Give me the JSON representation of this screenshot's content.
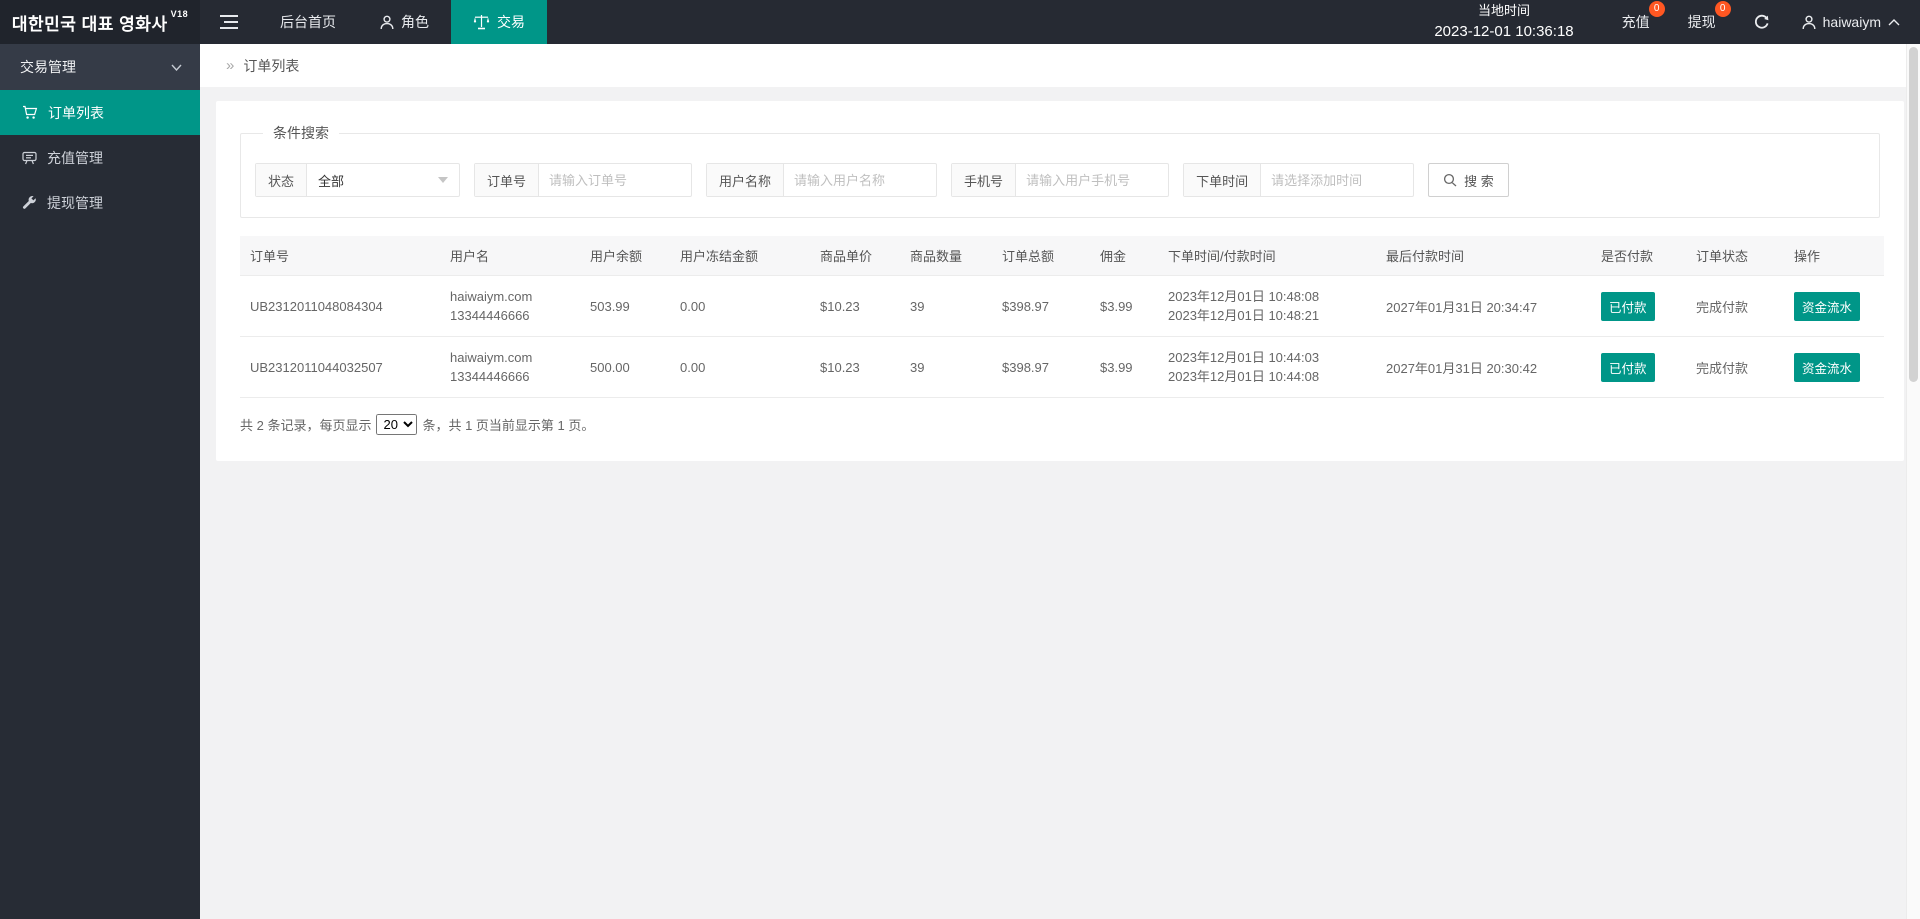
{
  "colors": {
    "accent": "#009688",
    "notification_badge": "#ff5722"
  },
  "topbar": {
    "logo": "대한민국 대표 영화사",
    "logo_version": "V18",
    "nav_home": "后台首页",
    "nav_role": "角色",
    "nav_trade": "交易",
    "local_time_label": "当地时间",
    "local_time_value": "2023-12-01 10:36:18",
    "recharge_label": "充值",
    "recharge_badge": "0",
    "withdraw_label": "提现",
    "withdraw_badge": "0",
    "username": "haiwaiym"
  },
  "sidebar": {
    "group_label": "交易管理",
    "items": [
      {
        "label": "订单列表"
      },
      {
        "label": "充值管理"
      },
      {
        "label": "提现管理"
      }
    ]
  },
  "breadcrumb": {
    "separator": "»",
    "current": "订单列表"
  },
  "search": {
    "legend": "条件搜索",
    "status_label": "状态",
    "status_value": "全部",
    "order_label": "订单号",
    "order_placeholder": "请输入订单号",
    "user_label": "用户名称",
    "user_placeholder": "请输入用户名称",
    "phone_label": "手机号",
    "phone_placeholder": "请输入用户手机号",
    "time_label": "下单时间",
    "time_placeholder": "请选择添加时间",
    "button_label": "搜 索"
  },
  "table": {
    "headers": [
      "订单号",
      "用户名",
      "用户余额",
      "用户冻结金额",
      "商品单价",
      "商品数量",
      "订单总额",
      "佣金",
      "下单时间/付款时间",
      "最后付款时间",
      "是否付款",
      "订单状态",
      "操作"
    ],
    "rows": [
      {
        "order_no": "UB2312011048084304",
        "user_name": "haiwaiym.com",
        "user_phone": "13344446666",
        "balance": "503.99",
        "frozen": "0.00",
        "unit_price": "$10.23",
        "quantity": "39",
        "total": "$398.97",
        "commission": "$3.99",
        "order_time": "2023年12月01日 10:48:08",
        "pay_time": "2023年12月01日 10:48:21",
        "last_pay_time": "2027年01月31日 20:34:47",
        "paid_badge": "已付款",
        "order_status": "完成付款",
        "action_label": "资金流水"
      },
      {
        "order_no": "UB2312011044032507",
        "user_name": "haiwaiym.com",
        "user_phone": "13344446666",
        "balance": "500.00",
        "frozen": "0.00",
        "unit_price": "$10.23",
        "quantity": "39",
        "total": "$398.97",
        "commission": "$3.99",
        "order_time": "2023年12月01日 10:44:03",
        "pay_time": "2023年12月01日 10:44:08",
        "last_pay_time": "2027年01月31日 20:30:42",
        "paid_badge": "已付款",
        "order_status": "完成付款",
        "action_label": "资金流水"
      }
    ]
  },
  "pagination": {
    "text_before": "共 2 条记录，每页显示",
    "page_size": "20",
    "text_after": "条，共 1 页当前显示第 1 页。"
  }
}
